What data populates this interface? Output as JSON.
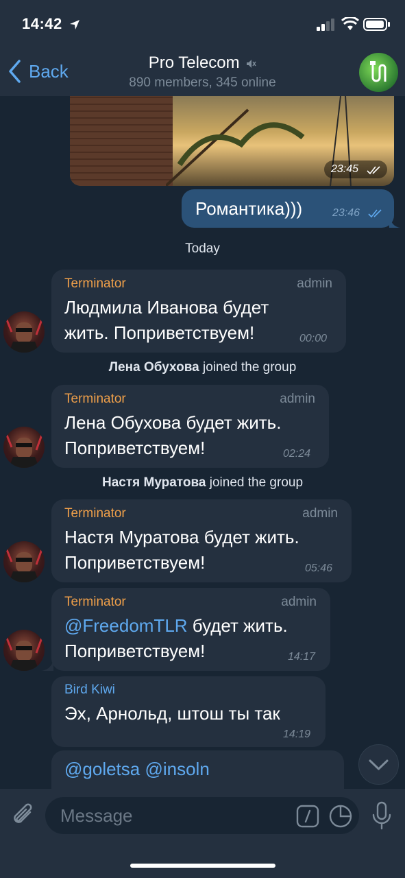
{
  "status": {
    "time": "14:42"
  },
  "nav": {
    "back_label": "Back",
    "title": "Pro Telecom",
    "subtitle": "890 members, 345 online"
  },
  "photo_message": {
    "time": "23:45"
  },
  "own_message": {
    "text": "Романтика)))",
    "time": "23:46"
  },
  "date_separator": "Today",
  "messages": [
    {
      "sender": "Terminator",
      "role": "admin",
      "line1": "Людмила Иванова будет",
      "line2": "жить. Поприветствуем!",
      "time": "00:00"
    },
    {
      "sender": "Terminator",
      "role": "admin",
      "line1": "Лена Обухова будет жить.",
      "line2": "Поприветствуем!",
      "time": "02:24"
    },
    {
      "sender": "Terminator",
      "role": "admin",
      "line1": "Настя Муратова будет жить.",
      "line2": "Поприветствуем!",
      "time": "05:46"
    },
    {
      "sender": "Terminator",
      "role": "admin",
      "mention": "@FreedomTLR",
      "line1_rest": " будет жить.",
      "line2": "Поприветствуем!",
      "time": "14:17"
    },
    {
      "sender": "Bird Kiwi",
      "line1": "Эх, Арнольд, штош ты так",
      "time": "14:19"
    },
    {
      "line1": "@goletsa @insoln"
    }
  ],
  "system_events": [
    {
      "name": "Лена Обухова",
      "action": "joined the group"
    },
    {
      "name": "Настя Муратова",
      "action": "joined the group"
    }
  ],
  "input": {
    "placeholder": "Message"
  },
  "colors": {
    "background": "#182533",
    "bar": "#24303f",
    "incoming": "#24303f",
    "outgoing": "#2b5278",
    "accent": "#5fa9ef",
    "admin_name": "#f0a04a"
  }
}
